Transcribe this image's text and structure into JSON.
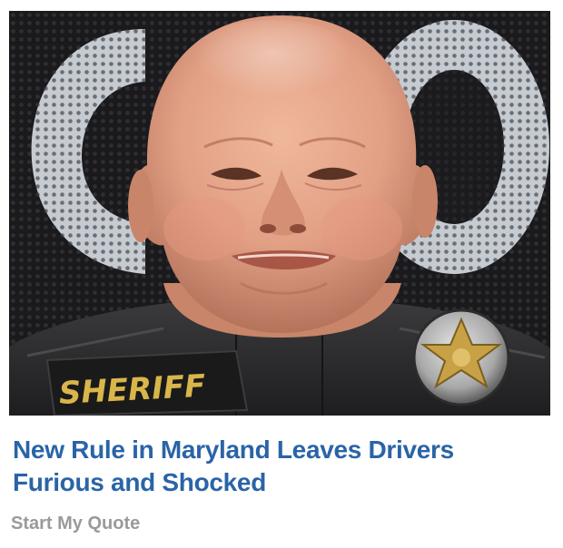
{
  "ad": {
    "image": {
      "subject": "bald-man-sheriff-uniform",
      "patch_text": "SHERIFF",
      "background_lettering": "CO"
    },
    "headline": "New Rule in Maryland Leaves Drivers Furious and Shocked",
    "cta_label": "Start My Quote"
  },
  "colors": {
    "headline": "#2a64a6",
    "cta": "#9a9a9a",
    "patch_gold": "#d9b54a",
    "skin": "#e2a58a"
  }
}
